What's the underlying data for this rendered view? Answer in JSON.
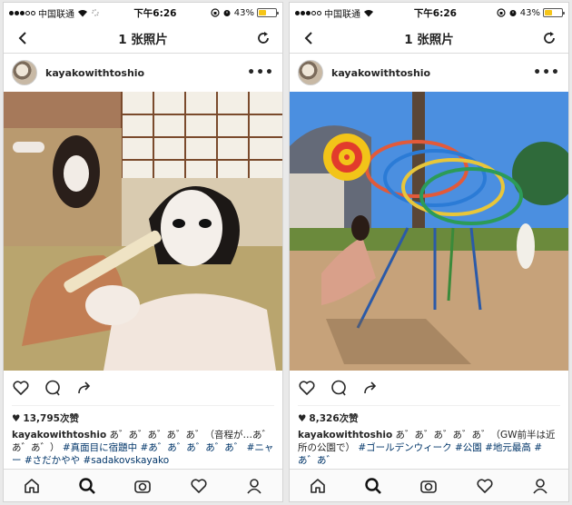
{
  "left": {
    "status": {
      "carrier": "中国联通",
      "time": "下午6:26",
      "battery": "43%"
    },
    "nav": {
      "title": "1 张照片"
    },
    "post": {
      "username": "kayakowithtoshio",
      "likes": "13,795次赞",
      "caption_user": "kayakowithtoshio",
      "caption_text": " あ゛あ゛あ゛あ゛あ゛（音程が…あ゛あ゛あ゛）",
      "caption_tags": "#真面目に宿題中 #あ゛あ゛あ゛あ゛あ゛ #ニャー #さだかやや #sadakovskayako"
    }
  },
  "right": {
    "status": {
      "carrier": "中国联通",
      "time": "下午6:26",
      "battery": "43%"
    },
    "nav": {
      "title": "1 张照片"
    },
    "post": {
      "username": "kayakowithtoshio",
      "likes": "8,326次赞",
      "caption_user": "kayakowithtoshio",
      "caption_text": " あ゛あ゛あ゛あ゛あ゛（GW前半は近所の公園で）",
      "caption_tags": "#ゴールデンウィーク #公園 #地元最高 #あ゛あ゛"
    }
  },
  "colors": {
    "link": "#003569",
    "battery": "#f5c518",
    "border": "#dbdbdb"
  },
  "icons": [
    "back-icon",
    "refresh-icon",
    "more-icon",
    "heart-icon",
    "comment-icon",
    "share-icon",
    "home-icon",
    "search-icon",
    "camera-icon",
    "activity-icon",
    "profile-icon"
  ]
}
